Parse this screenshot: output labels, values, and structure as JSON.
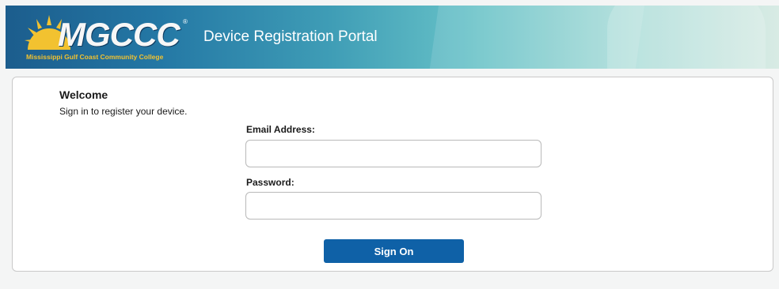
{
  "header": {
    "logo_text": "MGCCC",
    "logo_registered": "®",
    "logo_subtitle": "Mississippi Gulf Coast Community College",
    "title": "Device Registration Portal"
  },
  "welcome": {
    "title": "Welcome",
    "subtitle": "Sign in to register your device."
  },
  "form": {
    "email_label": "Email Address:",
    "email_value": "",
    "email_placeholder": "",
    "password_label": "Password:",
    "password_value": "",
    "password_placeholder": "",
    "submit_label": "Sign On"
  },
  "colors": {
    "header_dark": "#1c5d8d",
    "header_light": "#d8ebe4",
    "sun": "#f2c230",
    "button": "#0f61a7"
  },
  "icons": {
    "logo_mark": "sun-icon"
  }
}
